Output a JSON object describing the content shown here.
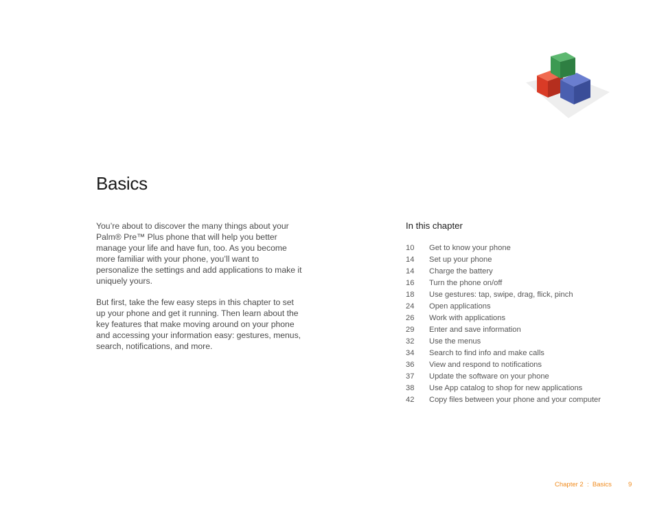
{
  "header": {
    "title": "Basics"
  },
  "intro": {
    "paragraphs": [
      "You’re about to discover the many things about your Palm® Pre™ Plus phone that will help you better manage your life and have fun, too. As you become more familiar with your phone, you’ll want to personalize the settings and add applications to make it uniquely yours.",
      "But first, take the few easy steps in this chapter to set up your phone and get it running. Then learn about the key features that make moving around on your phone and accessing your information easy: gestures, menus, search, notifications, and more."
    ]
  },
  "chapter": {
    "heading": "In this chapter",
    "items": [
      {
        "page": "10",
        "label": "Get to know your phone"
      },
      {
        "page": "14",
        "label": "Set up your phone"
      },
      {
        "page": "14",
        "label": "Charge the battery"
      },
      {
        "page": "16",
        "label": "Turn the phone on/off"
      },
      {
        "page": "18",
        "label": "Use gestures: tap, swipe, drag, flick, pinch"
      },
      {
        "page": "24",
        "label": "Open applications"
      },
      {
        "page": "26",
        "label": "Work with applications"
      },
      {
        "page": "29",
        "label": "Enter and save information"
      },
      {
        "page": "32",
        "label": "Use the menus"
      },
      {
        "page": "34",
        "label": "Search to find info and make calls"
      },
      {
        "page": "36",
        "label": "View and respond to notifications"
      },
      {
        "page": "37",
        "label": "Update the software on your phone"
      },
      {
        "page": "38",
        "label": "Use App catalog to shop for new applications"
      },
      {
        "page": "42",
        "label": "Copy files between your phone and your computer"
      }
    ]
  },
  "footer": {
    "section": "Chapter 2  :  Basics",
    "page": "9",
    "accent": "#f08a1c"
  },
  "graphic": {
    "icon": "building-blocks-icon",
    "colors": [
      "#e0412c",
      "#3c9a52",
      "#4a5fb0"
    ]
  }
}
